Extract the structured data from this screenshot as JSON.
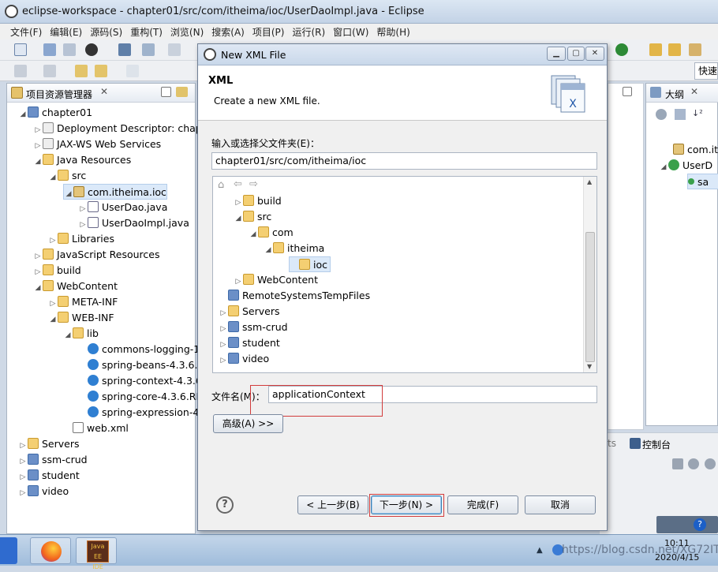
{
  "window": {
    "title": "eclipse-workspace - chapter01/src/com/itheima/ioc/UserDaoImpl.java - Eclipse"
  },
  "menu": [
    "文件(F)",
    "编辑(E)",
    "源码(S)",
    "重构(T)",
    "浏览(N)",
    "搜索(A)",
    "项目(P)",
    "运行(R)",
    "窗口(W)",
    "帮助(H)"
  ],
  "quick_access": "快速",
  "explorer": {
    "title": "项目资源管理器",
    "items": [
      {
        "label": "chapter01",
        "icon": "project-icon"
      },
      {
        "label": "Deployment Descriptor: chapte",
        "icon": "web-icon"
      },
      {
        "label": "JAX-WS Web Services",
        "icon": "web-icon"
      },
      {
        "label": "Java Resources",
        "icon": "folder-icon"
      },
      {
        "label": "src",
        "icon": "package-folder-icon"
      },
      {
        "label": "com.itheima.ioc",
        "icon": "package-icon"
      },
      {
        "label": "UserDao.java",
        "icon": "java-file-icon"
      },
      {
        "label": "UserDaoImpl.java",
        "icon": "java-file-icon"
      },
      {
        "label": "Libraries",
        "icon": "library-icon"
      },
      {
        "label": "JavaScript Resources",
        "icon": "folder-icon"
      },
      {
        "label": "build",
        "icon": "folder-icon"
      },
      {
        "label": "WebContent",
        "icon": "folder-icon"
      },
      {
        "label": "META-INF",
        "icon": "folder-icon"
      },
      {
        "label": "WEB-INF",
        "icon": "folder-icon"
      },
      {
        "label": "lib",
        "icon": "folder-icon"
      },
      {
        "label": "commons-logging-1",
        "icon": "jar-icon"
      },
      {
        "label": "spring-beans-4.3.6.R",
        "icon": "jar-icon"
      },
      {
        "label": "spring-context-4.3.6.",
        "icon": "jar-icon"
      },
      {
        "label": "spring-core-4.3.6.RE",
        "icon": "jar-icon"
      },
      {
        "label": "spring-expression-4.",
        "icon": "jar-icon"
      },
      {
        "label": "web.xml",
        "icon": "xml-file-icon"
      },
      {
        "label": "Servers",
        "icon": "folder-icon"
      },
      {
        "label": "ssm-crud",
        "icon": "project-icon"
      },
      {
        "label": "student",
        "icon": "project-icon"
      },
      {
        "label": "video",
        "icon": "project-icon"
      }
    ]
  },
  "outline": {
    "title": "大纲",
    "items": [
      "com.ite",
      "UserD",
      "sa"
    ]
  },
  "console": {
    "tab_prefix": "ts",
    "tab": "控制台"
  },
  "dialog": {
    "title": "New XML File",
    "header": "XML",
    "description": "Create a new XML file.",
    "parent_label": "输入或选择父文件夹(E)：",
    "parent_value": "chapter01/src/com/itheima/ioc",
    "folders": [
      {
        "label": "build"
      },
      {
        "label": "src"
      },
      {
        "label": "com"
      },
      {
        "label": "itheima"
      },
      {
        "label": "ioc"
      },
      {
        "label": "WebContent"
      },
      {
        "label": "RemoteSystemsTempFiles"
      },
      {
        "label": "Servers"
      },
      {
        "label": "ssm-crud"
      },
      {
        "label": "student"
      },
      {
        "label": "video"
      }
    ],
    "filename_label": "文件名(M)：",
    "filename_value": "applicationContext",
    "advanced_button": "高级(A) >>",
    "back_button": "< 上一步(B)",
    "next_button": "下一步(N) >",
    "finish_button": "完成(F)",
    "cancel_button": "取消"
  },
  "taskbar": {
    "clock_time": "10:11",
    "clock_date": "2020/4/15",
    "watermark": "https://blog.csdn.net/XG72IT"
  }
}
